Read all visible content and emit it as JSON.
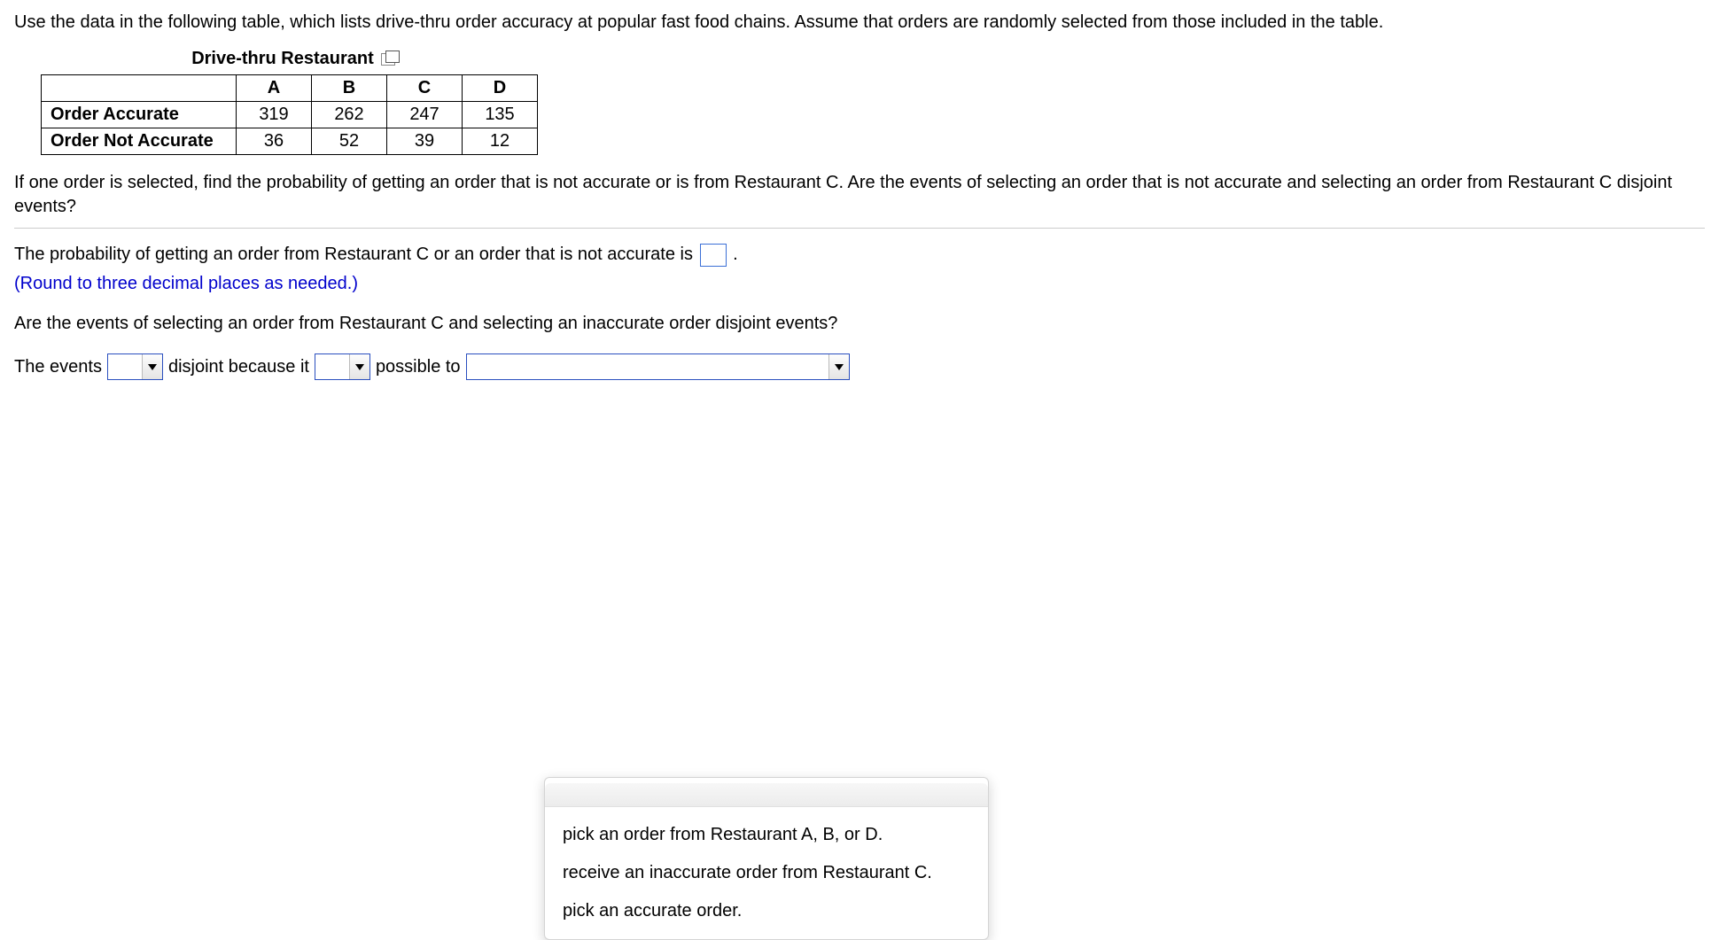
{
  "intro": "Use the data in the following table, which lists drive-thru order accuracy at popular fast food chains. Assume that orders are randomly selected from those included in the table.",
  "table": {
    "title": "Drive-thru Restaurant",
    "cols": [
      "A",
      "B",
      "C",
      "D"
    ],
    "rows": [
      {
        "label": "Order Accurate",
        "vals": [
          "319",
          "262",
          "247",
          "135"
        ]
      },
      {
        "label": "Order Not Accurate",
        "vals": [
          "36",
          "52",
          "39",
          "12"
        ]
      }
    ]
  },
  "question": "If one order is selected, find the probability of getting an order that is not accurate or is from Restaurant C. Are the events of selecting an order that is not accurate and selecting an order from Restaurant C disjoint events?",
  "ans1_pre": "The probability of getting an order from Restaurant C or an order that is not accurate is ",
  "ans1_post": ".",
  "hint": "(Round to three decimal places as needed.)",
  "q2": "Are the events of selecting an order from Restaurant C and selecting an inaccurate order disjoint events?",
  "sentence": {
    "p1": "The events",
    "p2": "disjoint because it",
    "p3": "possible to"
  },
  "dropdown3_options": [
    "pick an order from Restaurant A, B, or D.",
    "receive an inaccurate order from Restaurant C.",
    "pick an accurate order."
  ]
}
